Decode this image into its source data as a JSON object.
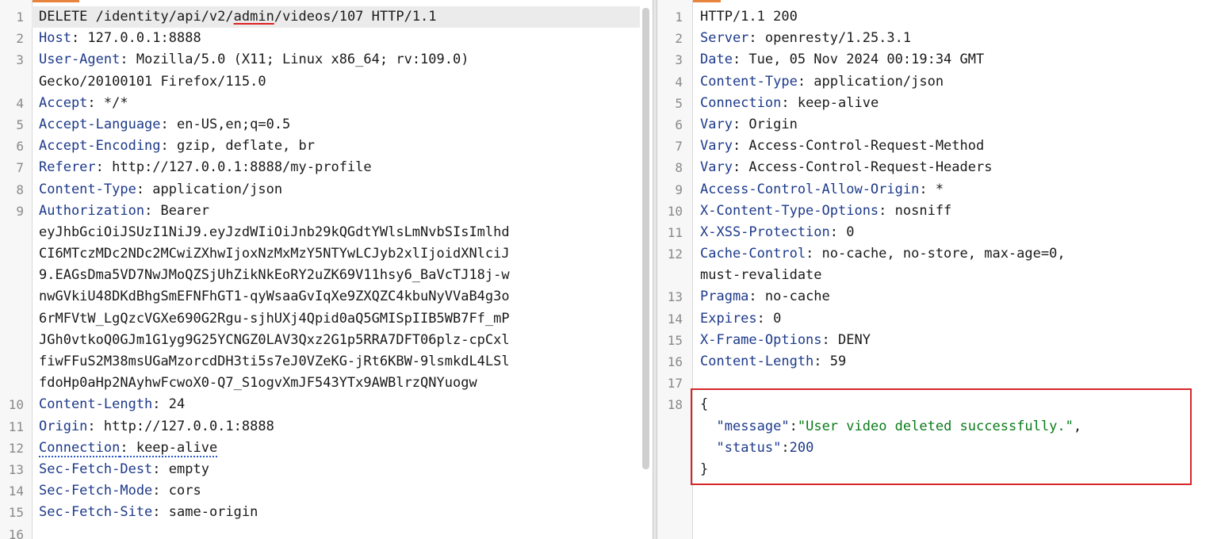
{
  "request": {
    "lines": [
      {
        "n": "1",
        "parts": [
          {
            "t": "DELETE /identity/api/v2/",
            "c": "plain"
          },
          {
            "t": "admin",
            "c": "plain underline-red"
          },
          {
            "t": "/videos/107 HTTP/1.1",
            "c": "plain"
          }
        ]
      },
      {
        "n": "2",
        "parts": [
          {
            "t": "Host",
            "c": "key"
          },
          {
            "t": ": 127.0.0.1:8888",
            "c": "plain"
          }
        ]
      },
      {
        "n": "3",
        "parts": [
          {
            "t": "User-Agent",
            "c": "key"
          },
          {
            "t": ": Mozilla/5.0 (X11; Linux x86_64; rv:109.0)",
            "c": "plain"
          }
        ]
      },
      {
        "n": "",
        "parts": [
          {
            "t": "Gecko/20100101 Firefox/115.0",
            "c": "plain"
          }
        ]
      },
      {
        "n": "4",
        "parts": [
          {
            "t": "Accept",
            "c": "key"
          },
          {
            "t": ": */*",
            "c": "plain"
          }
        ]
      },
      {
        "n": "5",
        "parts": [
          {
            "t": "Accept-Language",
            "c": "key"
          },
          {
            "t": ": en-US,en;q=0.5",
            "c": "plain"
          }
        ]
      },
      {
        "n": "6",
        "parts": [
          {
            "t": "Accept-Encoding",
            "c": "key"
          },
          {
            "t": ": gzip, deflate, br",
            "c": "plain"
          }
        ]
      },
      {
        "n": "7",
        "parts": [
          {
            "t": "Referer",
            "c": "key"
          },
          {
            "t": ": http://127.0.0.1:8888/my-profile",
            "c": "plain"
          }
        ]
      },
      {
        "n": "8",
        "parts": [
          {
            "t": "Content-Type",
            "c": "key"
          },
          {
            "t": ": application/json",
            "c": "plain"
          }
        ]
      },
      {
        "n": "9",
        "parts": [
          {
            "t": "Authorization",
            "c": "key"
          },
          {
            "t": ": Bearer",
            "c": "plain"
          }
        ]
      },
      {
        "n": "",
        "parts": [
          {
            "t": "eyJhbGciOiJSUzI1NiJ9.eyJzdWIiOiJnb29kQGdtYWlsLmNvbSIsImlhd",
            "c": "plain"
          }
        ]
      },
      {
        "n": "",
        "parts": [
          {
            "t": "CI6MTczMDc2NDc2MCwiZXhwIjoxNzMxMzY5NTYwLCJyb2xlIjoidXNlciJ",
            "c": "plain"
          }
        ]
      },
      {
        "n": "",
        "parts": [
          {
            "t": "9.EAGsDma5VD7NwJMoQZSjUhZikNkEoRY2uZK69V11hsy6_BaVcTJ18j-w",
            "c": "plain"
          }
        ]
      },
      {
        "n": "",
        "parts": [
          {
            "t": "nwGVkiU48DKdBhgSmEFNFhGT1-qyWsaaGvIqXe9ZXQZC4kbuNyVVaB4g3o",
            "c": "plain"
          }
        ]
      },
      {
        "n": "",
        "parts": [
          {
            "t": "6rMFVtW_LgQzcVGXe690G2Rgu-sjhUXj4Qpid0aQ5GMISpIIB5WB7Ff_mP",
            "c": "plain"
          }
        ]
      },
      {
        "n": "",
        "parts": [
          {
            "t": "JGh0vtkoQ0GJm1G1yg9G25YCNGZ0LAV3Qxz2G1p5RRA7DFT06plz-cpCxl",
            "c": "plain"
          }
        ]
      },
      {
        "n": "",
        "parts": [
          {
            "t": "fiwFFuS2M38msUGaMzorcdDH3ti5s7eJ0VZeKG-jRt6KBW-9lsmkdL4LSl",
            "c": "plain"
          }
        ]
      },
      {
        "n": "",
        "parts": [
          {
            "t": "fdoHp0aHp2NAyhwFcwoX0-Q7_S1ogvXmJF543YTx9AWBlrzQNYuogw",
            "c": "plain"
          }
        ]
      },
      {
        "n": "10",
        "parts": [
          {
            "t": "Content-Length",
            "c": "key"
          },
          {
            "t": ": 24",
            "c": "plain"
          }
        ]
      },
      {
        "n": "11",
        "parts": [
          {
            "t": "Origin",
            "c": "key"
          },
          {
            "t": ": http://127.0.0.1:8888",
            "c": "plain"
          }
        ]
      },
      {
        "n": "12",
        "parts": [
          {
            "t": "Connection",
            "c": "key underline-dotted"
          },
          {
            "t": ": keep-alive",
            "c": "plain underline-dotted"
          }
        ]
      },
      {
        "n": "13",
        "parts": [
          {
            "t": "Sec-Fetch-Dest",
            "c": "key"
          },
          {
            "t": ": empty",
            "c": "plain"
          }
        ]
      },
      {
        "n": "14",
        "parts": [
          {
            "t": "Sec-Fetch-Mode",
            "c": "key"
          },
          {
            "t": ": cors",
            "c": "plain"
          }
        ]
      },
      {
        "n": "15",
        "parts": [
          {
            "t": "Sec-Fetch-Site",
            "c": "key"
          },
          {
            "t": ": same-origin",
            "c": "plain"
          }
        ]
      },
      {
        "n": "16",
        "parts": []
      }
    ]
  },
  "response": {
    "lines": [
      {
        "n": "1",
        "parts": [
          {
            "t": "HTTP/1.1 200",
            "c": "plain"
          }
        ]
      },
      {
        "n": "2",
        "parts": [
          {
            "t": "Server",
            "c": "key"
          },
          {
            "t": ": openresty/1.25.3.1",
            "c": "plain"
          }
        ]
      },
      {
        "n": "3",
        "parts": [
          {
            "t": "Date",
            "c": "key"
          },
          {
            "t": ": Tue, 05 Nov 2024 00:19:34 GMT",
            "c": "plain"
          }
        ]
      },
      {
        "n": "4",
        "parts": [
          {
            "t": "Content-Type",
            "c": "key"
          },
          {
            "t": ": application/json",
            "c": "plain"
          }
        ]
      },
      {
        "n": "5",
        "parts": [
          {
            "t": "Connection",
            "c": "key"
          },
          {
            "t": ": keep-alive",
            "c": "plain"
          }
        ]
      },
      {
        "n": "6",
        "parts": [
          {
            "t": "Vary",
            "c": "key"
          },
          {
            "t": ": Origin",
            "c": "plain"
          }
        ]
      },
      {
        "n": "7",
        "parts": [
          {
            "t": "Vary",
            "c": "key"
          },
          {
            "t": ": Access-Control-Request-Method",
            "c": "plain"
          }
        ]
      },
      {
        "n": "8",
        "parts": [
          {
            "t": "Vary",
            "c": "key"
          },
          {
            "t": ": Access-Control-Request-Headers",
            "c": "plain"
          }
        ]
      },
      {
        "n": "9",
        "parts": [
          {
            "t": "Access-Control-Allow-Origin",
            "c": "key"
          },
          {
            "t": ": *",
            "c": "plain"
          }
        ]
      },
      {
        "n": "10",
        "parts": [
          {
            "t": "X-Content-Type-Options",
            "c": "key"
          },
          {
            "t": ": nosniff",
            "c": "plain"
          }
        ]
      },
      {
        "n": "11",
        "parts": [
          {
            "t": "X-XSS-Protection",
            "c": "key"
          },
          {
            "t": ": 0",
            "c": "plain"
          }
        ]
      },
      {
        "n": "12",
        "parts": [
          {
            "t": "Cache-Control",
            "c": "key"
          },
          {
            "t": ": no-cache, no-store, max-age=0,",
            "c": "plain"
          }
        ]
      },
      {
        "n": "",
        "parts": [
          {
            "t": "must-revalidate",
            "c": "plain"
          }
        ]
      },
      {
        "n": "13",
        "parts": [
          {
            "t": "Pragma",
            "c": "key"
          },
          {
            "t": ": no-cache",
            "c": "plain"
          }
        ]
      },
      {
        "n": "14",
        "parts": [
          {
            "t": "Expires",
            "c": "key"
          },
          {
            "t": ": 0",
            "c": "plain"
          }
        ]
      },
      {
        "n": "15",
        "parts": [
          {
            "t": "X-Frame-Options",
            "c": "key"
          },
          {
            "t": ": DENY",
            "c": "plain"
          }
        ]
      },
      {
        "n": "16",
        "parts": [
          {
            "t": "Content-Length",
            "c": "key"
          },
          {
            "t": ": 59",
            "c": "plain"
          }
        ]
      },
      {
        "n": "17",
        "parts": []
      },
      {
        "n": "18",
        "parts": [
          {
            "t": "{",
            "c": "plain"
          }
        ]
      },
      {
        "n": "",
        "parts": [
          {
            "t": "  ",
            "c": "plain"
          },
          {
            "t": "\"message\"",
            "c": "jkey"
          },
          {
            "t": ":",
            "c": "plain"
          },
          {
            "t": "\"User video deleted successfully.\"",
            "c": "jstr"
          },
          {
            "t": ",",
            "c": "plain"
          }
        ]
      },
      {
        "n": "",
        "parts": [
          {
            "t": "  ",
            "c": "plain"
          },
          {
            "t": "\"status\"",
            "c": "jkey"
          },
          {
            "t": ":",
            "c": "plain"
          },
          {
            "t": "200",
            "c": "jnum"
          }
        ]
      },
      {
        "n": "",
        "parts": [
          {
            "t": "}",
            "c": "plain"
          }
        ]
      }
    ]
  },
  "colors": {
    "header_key": "#1d3a8a",
    "json_string": "#0a7a1a",
    "highlight_border": "#d6262a",
    "tab_accent": "#e8843c"
  }
}
